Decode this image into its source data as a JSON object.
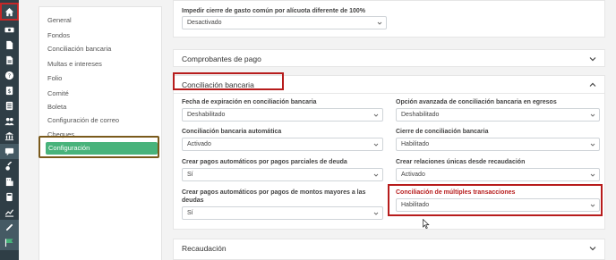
{
  "sidebar_icons": [
    "home-icon",
    "money-icon",
    "file-icon",
    "document-icon",
    "help-icon",
    "dollar-icon",
    "list-icon",
    "users-icon",
    "bank-icon",
    "chat-icon",
    "key-icon",
    "building-icon",
    "calculator-icon",
    "chart-icon",
    "wrench-icon",
    "flag-icon"
  ],
  "submenu": {
    "items": [
      "General",
      "Fondos",
      "Conciliación bancaria",
      "Multas e intereses",
      "Folio",
      "Comité",
      "Boleta",
      "Configuración de correo",
      "Cheques"
    ],
    "active": "Configuración"
  },
  "top_panel": {
    "label": "Impedir cierre de gasto común por alícuota diferente de 100%",
    "value": "Desactivado"
  },
  "comprobantes": {
    "title": "Comprobantes de pago"
  },
  "conciliacion": {
    "title": "Conciliación bancaria",
    "fields": {
      "f1": {
        "label": "Fecha de expiración en conciliación bancaria",
        "value": "Deshabilitado"
      },
      "f2": {
        "label": "Opción avanzada de conciliación bancaria en egresos",
        "value": "Deshabilitado"
      },
      "f3": {
        "label": "Conciliación bancaria automática",
        "value": "Activado"
      },
      "f4": {
        "label": "Cierre de conciliación bancaria",
        "value": "Habilitado"
      },
      "f5": {
        "label": "Crear pagos automáticos por pagos parciales de deuda",
        "value": "Sí"
      },
      "f6": {
        "label": "Crear relaciones únicas desde recaudación",
        "value": "Activado"
      },
      "f7": {
        "label": "Crear pagos automáticos por pagos de montos mayores a las deudas",
        "value": "Sí"
      },
      "f8": {
        "label": "Conciliación de múltiples transacciones",
        "value": "Habilitado"
      }
    }
  },
  "recaudacion": {
    "title": "Recaudación"
  },
  "colors": {
    "rail": "#2f3e46",
    "active": "#48b37b",
    "highlight": "#b71c1c",
    "f8_label": "#b71c1c"
  }
}
